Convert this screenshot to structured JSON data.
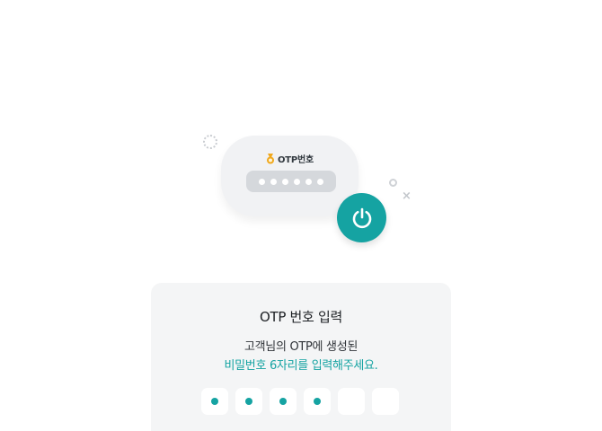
{
  "illustration": {
    "card_label": "OTP번호",
    "masked_digit_count": 6,
    "card_icon": "medal-icon",
    "action_icon": "power-icon",
    "accent_color": "#15a3a2",
    "medal_color": "#f0a81c"
  },
  "panel": {
    "title": "OTP 번호 입력",
    "desc_line1": "고객님의 OTP에 생성된",
    "desc_line2": "비밀번호 6자리를 입력해주세요."
  },
  "pin": {
    "length": 6,
    "filled": 4
  }
}
